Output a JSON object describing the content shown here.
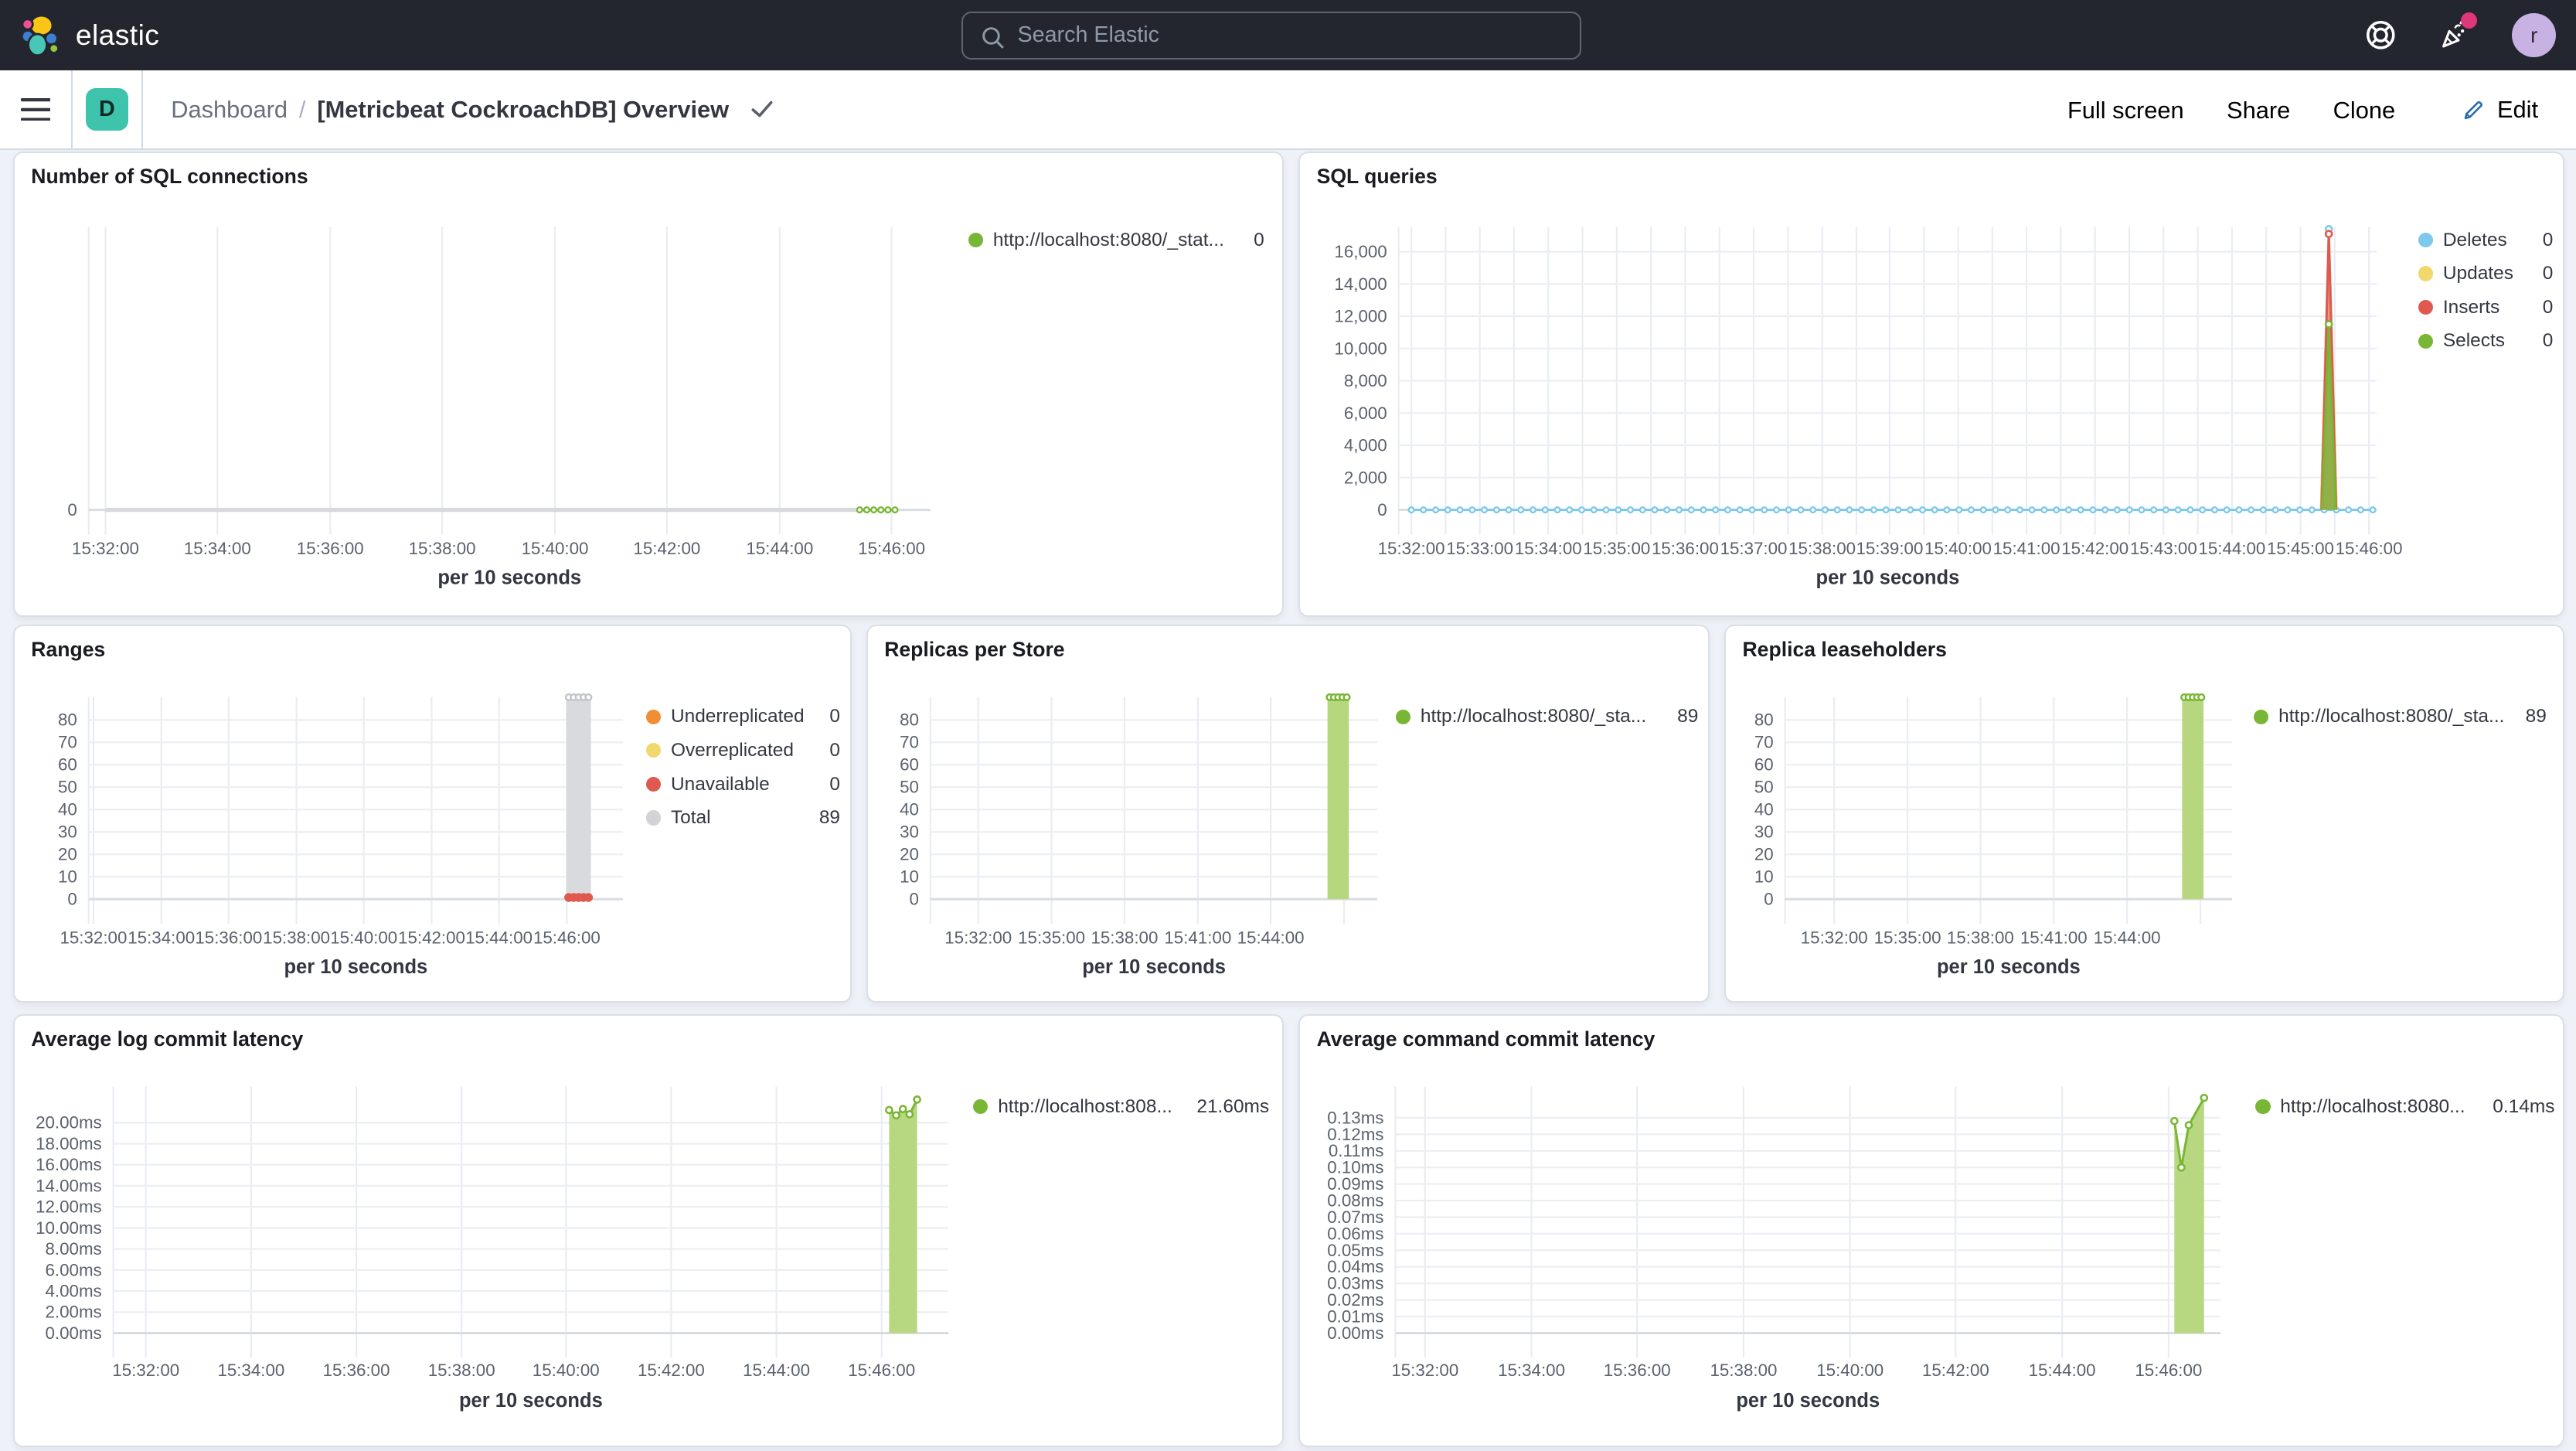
{
  "header": {
    "brand": "elastic",
    "search_placeholder": "Search Elastic",
    "avatar_initial": "r",
    "colors": {
      "bar_bg": "#23262e",
      "notification_dot": "#e0367b",
      "avatar_bg": "#c8b2e4"
    }
  },
  "navbar": {
    "dashboard_badge": "D",
    "breadcrumb": {
      "root": "Dashboard",
      "separator": "/",
      "current": "[Metricbeat CockroachDB] Overview"
    },
    "actions": {
      "full_screen": "Full screen",
      "share": "Share",
      "clone": "Clone",
      "edit": "Edit"
    },
    "colors": {
      "badge_bg": "#3ec3ac",
      "link": "#2a6cb0"
    }
  },
  "panels": [
    {
      "title": "Number of SQL connections",
      "legend": [
        {
          "label": "http://localhost:8080/_stat...",
          "value": "0",
          "color": "#7ab635"
        }
      ],
      "chart": {
        "type": "line",
        "xlabel": "per 10 seconds",
        "ylim": [
          -0.5,
          10.76
        ],
        "plot": {
          "x0": 45,
          "x1": 557,
          "y0": 45,
          "y1": 225
        },
        "tick_y": 244,
        "xlabel_y": 262,
        "x_minor": false,
        "y_ticks": [
          {
            "v": 0,
            "label": "0"
          }
        ],
        "x_ticks": [
          {
            "f": 0.02,
            "label": "15:32:00"
          },
          {
            "f": 0.153,
            "label": "15:34:00"
          },
          {
            "f": 0.287,
            "label": "15:36:00"
          },
          {
            "f": 0.42,
            "label": "15:38:00"
          },
          {
            "f": 0.554,
            "label": "15:40:00"
          },
          {
            "f": 0.687,
            "label": "15:42:00"
          },
          {
            "f": 0.821,
            "label": "15:44:00"
          },
          {
            "f": 0.954,
            "label": "15:46:00"
          }
        ],
        "series": [
          {
            "kind": "line",
            "color": "#d7d9dd",
            "w": 2.5,
            "pts": [
              [
                0.02,
                0
              ],
              [
                0.916,
                0
              ]
            ]
          },
          {
            "kind": "line",
            "color": "#7ab635",
            "w": 1.4,
            "pts": [
              [
                0.916,
                0
              ],
              [
                0.958,
                0
              ]
            ],
            "markers_n": 6
          }
        ]
      }
    },
    {
      "title": "SQL queries",
      "legend": [
        {
          "label": "Deletes",
          "value": "0",
          "color": "#7dc9ec"
        },
        {
          "label": "Updates",
          "value": "0",
          "color": "#f1d86d"
        },
        {
          "label": "Inserts",
          "value": "0",
          "color": "#e0594f"
        },
        {
          "label": "Selects",
          "value": "0",
          "color": "#7ab635"
        }
      ],
      "chart": {
        "type": "line",
        "xlabel": "per 10 seconds",
        "ylim": [
          -815,
          17529
        ],
        "plot": {
          "x0": 60,
          "x1": 655,
          "y0": 45,
          "y1": 225
        },
        "tick_y": 244,
        "xlabel_y": 262,
        "x_minor": true,
        "y_ticks": [
          {
            "v": 0,
            "label": "0"
          },
          {
            "v": 2000,
            "label": "2,000"
          },
          {
            "v": 4000,
            "label": "4,000"
          },
          {
            "v": 6000,
            "label": "6,000"
          },
          {
            "v": 8000,
            "label": "8,000"
          },
          {
            "v": 10000,
            "label": "10,000"
          },
          {
            "v": 12000,
            "label": "12,000"
          },
          {
            "v": 14000,
            "label": "14,000"
          },
          {
            "v": 16000,
            "label": "16,000"
          }
        ],
        "x_ticks": [
          {
            "f": 0.013,
            "label": "15:32:00"
          },
          {
            "f": 0.083,
            "label": "15:33:00"
          },
          {
            "f": 0.153,
            "label": "15:34:00"
          },
          {
            "f": 0.223,
            "label": "15:35:00"
          },
          {
            "f": 0.293,
            "label": "15:36:00"
          },
          {
            "f": 0.363,
            "label": "15:37:00"
          },
          {
            "f": 0.433,
            "label": "15:38:00"
          },
          {
            "f": 0.502,
            "label": "15:39:00"
          },
          {
            "f": 0.572,
            "label": "15:40:00"
          },
          {
            "f": 0.642,
            "label": "15:41:00"
          },
          {
            "f": 0.712,
            "label": "15:42:00"
          },
          {
            "f": 0.782,
            "label": "15:43:00"
          },
          {
            "f": 0.852,
            "label": "15:44:00"
          },
          {
            "f": 0.922,
            "label": "15:45:00"
          },
          {
            "f": 0.992,
            "label": "15:46:00"
          }
        ],
        "series": [
          {
            "kind": "line",
            "color": "#7dc9ec",
            "w": 1.3,
            "pts": [
              [
                0.013,
                0
              ],
              [
                0.996,
                0
              ]
            ],
            "markers_n": 80
          },
          {
            "kind": "area",
            "color": "#7dc9ec",
            "fill": "rgba(125,201,236,0.45)",
            "pts": [
              [
                0.943,
                0
              ],
              [
                0.951,
                17400
              ],
              [
                0.959,
                0
              ]
            ],
            "peak": true
          },
          {
            "kind": "area",
            "color": "#f1d86d",
            "fill": "rgba(241,216,109,0.45)",
            "pts": [
              [
                0.943,
                0
              ],
              [
                0.951,
                17150
              ],
              [
                0.959,
                0
              ]
            ]
          },
          {
            "kind": "area",
            "color": "#e0594f",
            "fill": "rgba(224,89,79,0.5)",
            "pts": [
              [
                0.9435,
                0
              ],
              [
                0.951,
                17100
              ],
              [
                0.9585,
                0
              ]
            ],
            "peak": true
          },
          {
            "kind": "area",
            "color": "#7ab635",
            "fill": "rgba(122,182,53,0.75)",
            "pts": [
              [
                0.944,
                0
              ],
              [
                0.951,
                11500
              ],
              [
                0.958,
                0
              ]
            ],
            "peak": true
          }
        ]
      }
    },
    {
      "title": "Ranges",
      "legend": [
        {
          "label": "Underreplicated",
          "value": "0",
          "color": "#ef8e33"
        },
        {
          "label": "Overreplicated",
          "value": "0",
          "color": "#f1d86d"
        },
        {
          "label": "Unavailable",
          "value": "0",
          "color": "#e0594f"
        },
        {
          "label": "Total",
          "value": "89",
          "color": "#d2d3d6"
        }
      ],
      "chart": {
        "type": "bar",
        "xlabel": "per 10 seconds",
        "ylim": [
          -5.87,
          90.28
        ],
        "plot": {
          "x0": 45,
          "x1": 370,
          "y0": 43,
          "y1": 174
        },
        "tick_y": 193,
        "xlabel_y": 211,
        "x_minor": false,
        "y_ticks": [
          {
            "v": 0,
            "label": "0"
          },
          {
            "v": 10,
            "label": "10"
          },
          {
            "v": 20,
            "label": "20"
          },
          {
            "v": 30,
            "label": "30"
          },
          {
            "v": 40,
            "label": "40"
          },
          {
            "v": 50,
            "label": "50"
          },
          {
            "v": 60,
            "label": "60"
          },
          {
            "v": 70,
            "label": "70"
          },
          {
            "v": 80,
            "label": "80"
          }
        ],
        "x_ticks": [
          {
            "f": 0.009,
            "label": "15:32:00"
          },
          {
            "f": 0.136,
            "label": "15:34:00"
          },
          {
            "f": 0.262,
            "label": "15:36:00"
          },
          {
            "f": 0.389,
            "label": "15:38:00"
          },
          {
            "f": 0.515,
            "label": "15:40:00"
          },
          {
            "f": 0.642,
            "label": "15:42:00"
          },
          {
            "f": 0.768,
            "label": "15:44:00"
          },
          {
            "f": 0.895,
            "label": "15:46:00"
          }
        ],
        "series": [
          {
            "kind": "bar",
            "f": 0.917,
            "bw": 15,
            "v": 89,
            "color": "#d9dadd",
            "top_dots": "#c2c5cb",
            "bottom_dots": "#e0594f"
          }
        ]
      }
    },
    {
      "title": "Replicas per Store",
      "legend": [
        {
          "label": "http://localhost:8080/_sta...",
          "value": "89",
          "color": "#7ab635"
        }
      ],
      "chart": {
        "type": "bar",
        "xlabel": "per 10 seconds",
        "ylim": [
          -5.87,
          90.28
        ],
        "plot": {
          "x0": 38,
          "x1": 310,
          "y0": 43,
          "y1": 174
        },
        "tick_y": 193,
        "xlabel_y": 211,
        "x_minor": false,
        "y_ticks": [
          {
            "v": 0,
            "label": "0"
          },
          {
            "v": 10,
            "label": "10"
          },
          {
            "v": 20,
            "label": "20"
          },
          {
            "v": 30,
            "label": "30"
          },
          {
            "v": 40,
            "label": "40"
          },
          {
            "v": 50,
            "label": "50"
          },
          {
            "v": 60,
            "label": "60"
          },
          {
            "v": 70,
            "label": "70"
          },
          {
            "v": 80,
            "label": "80"
          }
        ],
        "x_ticks": [
          {
            "f": 0.107,
            "label": "15:32:00"
          },
          {
            "f": 0.271,
            "label": "15:35:00"
          },
          {
            "f": 0.434,
            "label": "15:38:00"
          },
          {
            "f": 0.598,
            "label": "15:41:00"
          },
          {
            "f": 0.761,
            "label": "15:44:00"
          }
        ],
        "series": [
          {
            "kind": "bar",
            "f": 0.912,
            "bw": 13,
            "v": 89,
            "color": "#b6d77e",
            "top_dots": "#7ab635"
          }
        ]
      }
    },
    {
      "title": "Replica leaseholders",
      "legend": [
        {
          "label": "http://localhost:8080/_sta...",
          "value": "89",
          "color": "#7ab635"
        }
      ],
      "chart": {
        "type": "bar",
        "xlabel": "per 10 seconds",
        "ylim": [
          -5.87,
          90.28
        ],
        "plot": {
          "x0": 36,
          "x1": 308,
          "y0": 43,
          "y1": 174
        },
        "tick_y": 193,
        "xlabel_y": 211,
        "x_minor": false,
        "y_ticks": [
          {
            "v": 0,
            "label": "0"
          },
          {
            "v": 10,
            "label": "10"
          },
          {
            "v": 20,
            "label": "20"
          },
          {
            "v": 30,
            "label": "30"
          },
          {
            "v": 40,
            "label": "40"
          },
          {
            "v": 50,
            "label": "50"
          },
          {
            "v": 60,
            "label": "60"
          },
          {
            "v": 70,
            "label": "70"
          },
          {
            "v": 80,
            "label": "80"
          }
        ],
        "x_ticks": [
          {
            "f": 0.11,
            "label": "15:32:00"
          },
          {
            "f": 0.274,
            "label": "15:35:00"
          },
          {
            "f": 0.437,
            "label": "15:38:00"
          },
          {
            "f": 0.601,
            "label": "15:41:00"
          },
          {
            "f": 0.765,
            "label": "15:44:00"
          }
        ],
        "series": [
          {
            "kind": "bar",
            "f": 0.912,
            "bw": 13,
            "v": 89,
            "color": "#b6d77e",
            "top_dots": "#7ab635"
          }
        ]
      }
    },
    {
      "title": "Average log commit latency",
      "legend": [
        {
          "label": "http://localhost:808...",
          "value": "21.60ms",
          "color": "#7ab635"
        }
      ],
      "chart": {
        "type": "area",
        "xlabel": "per 10 seconds",
        "ylim": [
          -1.25,
          23.44
        ],
        "plot": {
          "x0": 60,
          "x1": 568,
          "y0": 43,
          "y1": 201
        },
        "tick_y": 219,
        "xlabel_y": 238,
        "x_minor": false,
        "y_ticks": [
          {
            "v": 0,
            "label": "0.00ms"
          },
          {
            "v": 2,
            "label": "2.00ms"
          },
          {
            "v": 4,
            "label": "4.00ms"
          },
          {
            "v": 6,
            "label": "6.00ms"
          },
          {
            "v": 8,
            "label": "8.00ms"
          },
          {
            "v": 10,
            "label": "10.00ms"
          },
          {
            "v": 12,
            "label": "12.00ms"
          },
          {
            "v": 14,
            "label": "14.00ms"
          },
          {
            "v": 16,
            "label": "16.00ms"
          },
          {
            "v": 18,
            "label": "18.00ms"
          },
          {
            "v": 20,
            "label": "20.00ms"
          }
        ],
        "x_ticks": [
          {
            "f": 0.039,
            "label": "15:32:00"
          },
          {
            "f": 0.165,
            "label": "15:34:00"
          },
          {
            "f": 0.291,
            "label": "15:36:00"
          },
          {
            "f": 0.417,
            "label": "15:38:00"
          },
          {
            "f": 0.542,
            "label": "15:40:00"
          },
          {
            "f": 0.668,
            "label": "15:42:00"
          },
          {
            "f": 0.794,
            "label": "15:44:00"
          },
          {
            "f": 0.92,
            "label": "15:46:00"
          }
        ],
        "series": [
          {
            "kind": "area",
            "color": "#7ab635",
            "fill": "#b7d780",
            "markers": true,
            "pts": [
              [
                0.929,
                21.2
              ],
              [
                0.9375,
                20.7
              ],
              [
                0.9455,
                21.3
              ],
              [
                0.9535,
                20.8
              ],
              [
                0.9625,
                22.2
              ]
            ]
          }
        ]
      }
    },
    {
      "title": "Average command commit latency",
      "legend": [
        {
          "label": "http://localhost:8080...",
          "value": "0.14ms",
          "color": "#7ab635"
        }
      ],
      "chart": {
        "type": "area",
        "xlabel": "per 10 seconds",
        "ylim": [
          -0.00793,
          0.14886
        ],
        "plot": {
          "x0": 58,
          "x1": 560,
          "y0": 43,
          "y1": 201
        },
        "tick_y": 219,
        "xlabel_y": 238,
        "x_minor": false,
        "y_ticks": [
          {
            "v": 0,
            "label": "0.00ms"
          },
          {
            "v": 0.01,
            "label": "0.01ms"
          },
          {
            "v": 0.02,
            "label": "0.02ms"
          },
          {
            "v": 0.03,
            "label": "0.03ms"
          },
          {
            "v": 0.04,
            "label": "0.04ms"
          },
          {
            "v": 0.05,
            "label": "0.05ms"
          },
          {
            "v": 0.06,
            "label": "0.06ms"
          },
          {
            "v": 0.07,
            "label": "0.07ms"
          },
          {
            "v": 0.08,
            "label": "0.08ms"
          },
          {
            "v": 0.09,
            "label": "0.09ms"
          },
          {
            "v": 0.1,
            "label": "0.10ms"
          },
          {
            "v": 0.11,
            "label": "0.11ms"
          },
          {
            "v": 0.12,
            "label": "0.12ms"
          },
          {
            "v": 0.13,
            "label": "0.13ms"
          }
        ],
        "x_ticks": [
          {
            "f": 0.036,
            "label": "15:32:00"
          },
          {
            "f": 0.165,
            "label": "15:34:00"
          },
          {
            "f": 0.293,
            "label": "15:36:00"
          },
          {
            "f": 0.422,
            "label": "15:38:00"
          },
          {
            "f": 0.551,
            "label": "15:40:00"
          },
          {
            "f": 0.679,
            "label": "15:42:00"
          },
          {
            "f": 0.808,
            "label": "15:44:00"
          },
          {
            "f": 0.937,
            "label": "15:46:00"
          }
        ],
        "series": [
          {
            "kind": "area",
            "color": "#7ab635",
            "fill": "#b7d780",
            "markers": true,
            "pts": [
              [
                0.944,
                0.128
              ],
              [
                0.9525,
                0.1
              ],
              [
                0.9615,
                0.1255
              ],
              [
                0.98,
                0.142
              ]
            ]
          }
        ]
      }
    }
  ]
}
